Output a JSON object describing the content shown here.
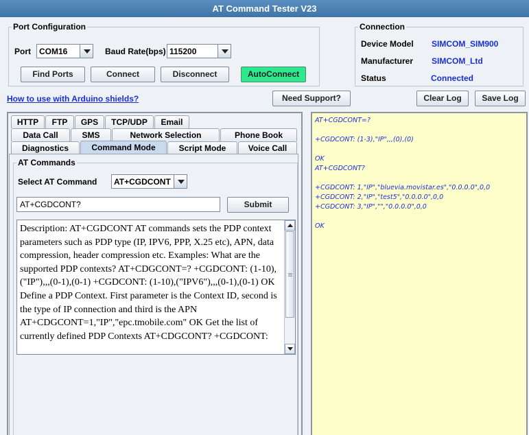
{
  "window": {
    "title": "AT Command Tester V23"
  },
  "port_config": {
    "title": "Port Configuration",
    "port_label": "Port",
    "port_value": "COM16",
    "baud_label": "Baud Rate(bps)",
    "baud_value": "115200",
    "find_ports": "Find Ports",
    "connect": "Connect",
    "disconnect": "Disconnect",
    "autoconnect": "AutoConnect"
  },
  "connection": {
    "title": "Connection",
    "device_model_label": "Device Model",
    "device_model": "SIMCOM_SIM900",
    "manufacturer_label": "Manufacturer",
    "manufacturer": "SIMCOM_Ltd",
    "status_label": "Status",
    "status": "Connected"
  },
  "links": {
    "arduino": "How to use with Arduino shields?"
  },
  "buttons": {
    "support": "Need Support?",
    "clear_log": "Clear Log",
    "save_log": "Save Log"
  },
  "tabs": {
    "row1": [
      "HTTP",
      "FTP",
      "GPS",
      "TCP/UDP",
      "Email"
    ],
    "row2": [
      "Data Call",
      "SMS",
      "Network Selection",
      "Phone Book"
    ],
    "row3": [
      "Diagnostics",
      "Command Mode",
      "Script Mode",
      "Voice Call"
    ],
    "selected": "Command Mode"
  },
  "at_commands": {
    "title": "AT Commands",
    "select_label": "Select AT Command",
    "select_value": "AT+CGDCONT",
    "command_input": "AT+CGDCONT?",
    "submit": "Submit",
    "description": "Description: AT+CGDCONT AT commands sets the PDP context parameters such as PDP type (IP, IPV6, PPP, X.25 etc), APN, data compression, header compression etc. Examples: What are the supported PDP contexts? AT+CDGCONT=? +CGDCONT: (1-10),(\"IP\"),,,(0-1),(0-1) +CGDCONT: (1-10),(\"IPV6\"),,,(0-1),(0-1) OK Define a PDP Context. First parameter is the Context ID, second is the type of IP connection and third is the APN AT+CDGCONT=1,\"IP\",\"epc.tmobile.com\" OK Get the list of currently defined PDP Contexts AT+CDGCONT? +CGDCONT:"
  },
  "log": {
    "lines": [
      "AT+CGDCONT=?",
      "",
      "+CGDCONT: (1-3),\"IP\",,,(0),(0)",
      "",
      "OK",
      "AT+CGDCONT?",
      "",
      "+CGDCONT: 1,\"IP\",\"bluevia.movistar.es\",\"0.0.0.0\",0,0",
      "+CGDCONT: 2,\"IP\",\"test5\",\"0.0.0.0\",0,0",
      "+CGDCONT: 3,\"IP\",\"\",\"0.0.0.0\",0,0",
      "",
      "OK"
    ]
  }
}
